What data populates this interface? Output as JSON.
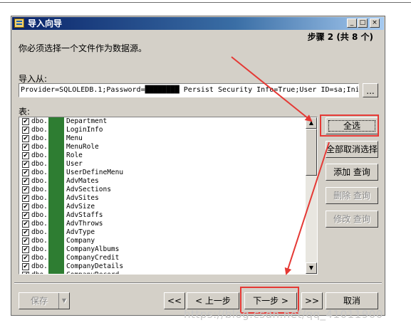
{
  "window": {
    "title": "导入向导",
    "step_text": "步骤 2 (共 8 个)",
    "instruction": "你必须选择一个文件作为数据源。",
    "controls": {
      "minimize": "_",
      "maximize": "□",
      "close": "×"
    }
  },
  "import_from": {
    "label": "导入从:",
    "value": "Provider=SQLOLEDB.1;Password=████████ Persist Security Info=True;User ID=sa;Ini",
    "browse_label": "..."
  },
  "tables": {
    "label": "表:",
    "items": [
      {
        "schema": "dbo.",
        "name": "Department",
        "checked": true
      },
      {
        "schema": "dbo.",
        "name": "LoginInfo",
        "checked": true
      },
      {
        "schema": "dbo.",
        "name": "Menu",
        "checked": true
      },
      {
        "schema": "dbo.",
        "name": "MenuRole",
        "checked": true
      },
      {
        "schema": "dbo.",
        "name": "Role",
        "checked": true
      },
      {
        "schema": "dbo.",
        "name": "User",
        "checked": true
      },
      {
        "schema": "dbo.",
        "name": "UserDefineMenu",
        "checked": true
      },
      {
        "schema": "dbo.",
        "name": "AdvMates",
        "checked": true
      },
      {
        "schema": "dbo.",
        "name": "AdvSections",
        "checked": true
      },
      {
        "schema": "dbo.",
        "name": "AdvSites",
        "checked": true
      },
      {
        "schema": "dbo.",
        "name": "AdvSize",
        "checked": true
      },
      {
        "schema": "dbo.",
        "name": "AdvStaffs",
        "checked": true
      },
      {
        "schema": "dbo.",
        "name": "AdvThrows",
        "checked": true
      },
      {
        "schema": "dbo.",
        "name": "AdvType",
        "checked": true
      },
      {
        "schema": "dbo.",
        "name": "Company",
        "checked": true
      },
      {
        "schema": "dbo.",
        "name": "CompanyAlbums",
        "checked": true
      },
      {
        "schema": "dbo.",
        "name": "CompanyCredit",
        "checked": true
      },
      {
        "schema": "dbo.",
        "name": "CompanyDetails",
        "checked": true
      },
      {
        "schema": "dbo.",
        "name": "CompanyRecord",
        "checked": true
      }
    ]
  },
  "side_buttons": {
    "select_all": "全选",
    "deselect_all": "全部取消选择",
    "add_query": "添加 查询",
    "delete_query": "删除 查询",
    "edit_query": "修改 查询"
  },
  "bottom_buttons": {
    "save": "保存",
    "first": "<<",
    "prev": "< 上一步",
    "next": "下一步 >",
    "last": ">>",
    "cancel": "取消"
  },
  "watermark": "https://blog.csdn.net/qq_41011900",
  "colors": {
    "annotation": "#e53935",
    "redaction": "#2e7d32",
    "title_bar": "#0a246a"
  }
}
